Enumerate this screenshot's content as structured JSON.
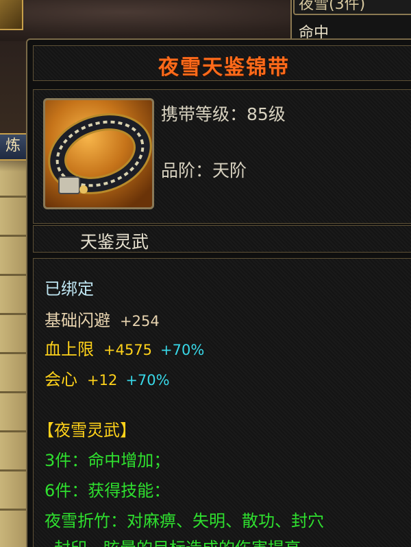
{
  "top_right": {
    "title": "夜雪(3件)",
    "line": "命中"
  },
  "side_tab": {
    "label": "炼"
  },
  "tooltip": {
    "item_name": "夜雪天鉴锦带",
    "level_label": "携带等级：85级",
    "grade_label": "品阶：天阶",
    "set_name": "天鉴灵武",
    "bound": "已绑定",
    "stats": [
      {
        "name": "基础闪避",
        "value": "+254",
        "bonus": ""
      },
      {
        "name": "血上限",
        "value": "+4575",
        "bonus": "+70%"
      },
      {
        "name": "会心",
        "value": "+12",
        "bonus": "+70%"
      }
    ],
    "set_title": "【夜雪灵武】",
    "set_3": "3件：命中增加；",
    "set_6": "6件：获得技能：",
    "skill_desc": "夜雪折竹：对麻痹、失明、散功、封穴",
    "skill_desc_2": "、封印、眩晕的目标造成的伤害提高"
  },
  "colors": {
    "item_name": "#ff6a1a",
    "bound": "#bfe6f2",
    "stat_yellow": "#ffd21a",
    "stat_pct": "#38d8e8",
    "set_green": "#2fe02f"
  },
  "icons": {
    "item": "belt-icon"
  }
}
